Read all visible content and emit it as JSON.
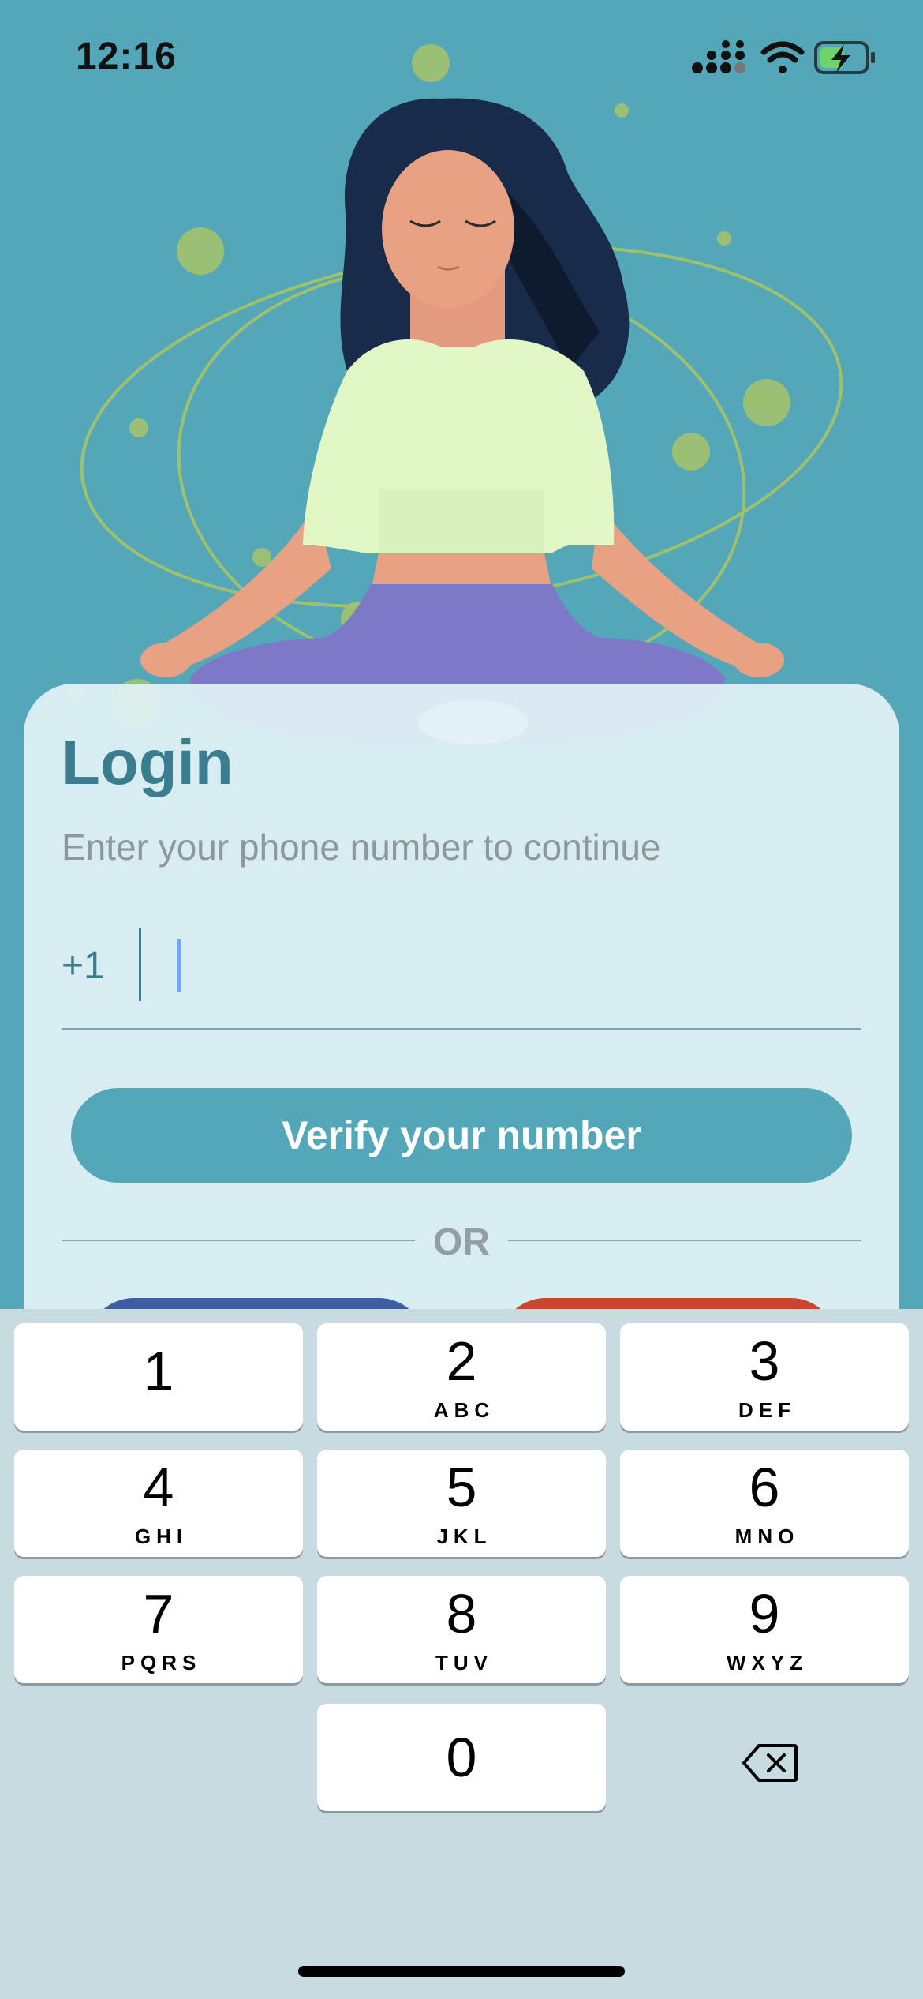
{
  "status_bar": {
    "time": "12:16",
    "icons": [
      "cellular-signal-icon",
      "wifi-icon",
      "battery-charging-icon"
    ]
  },
  "login": {
    "title": "Login",
    "subtitle": "Enter your phone number to continue",
    "country_code": "+1",
    "phone_value": "",
    "phone_placeholder": "",
    "verify_label": "Verify your number",
    "or_label": "OR"
  },
  "keypad": {
    "keys": [
      {
        "num": "1",
        "letters": ""
      },
      {
        "num": "2",
        "letters": "ABC"
      },
      {
        "num": "3",
        "letters": "DEF"
      },
      {
        "num": "4",
        "letters": "GHI"
      },
      {
        "num": "5",
        "letters": "JKL"
      },
      {
        "num": "6",
        "letters": "MNO"
      },
      {
        "num": "7",
        "letters": "PQRS"
      },
      {
        "num": "8",
        "letters": "TUV"
      },
      {
        "num": "9",
        "letters": "WXYZ"
      },
      {
        "num": "0",
        "letters": ""
      }
    ],
    "backspace_icon": "backspace-icon"
  },
  "colors": {
    "background": "#54a7b8",
    "accent": "#3a7d8f",
    "button": "#54a7b8",
    "facebook": "#3c5ea3",
    "google": "#c94530"
  }
}
